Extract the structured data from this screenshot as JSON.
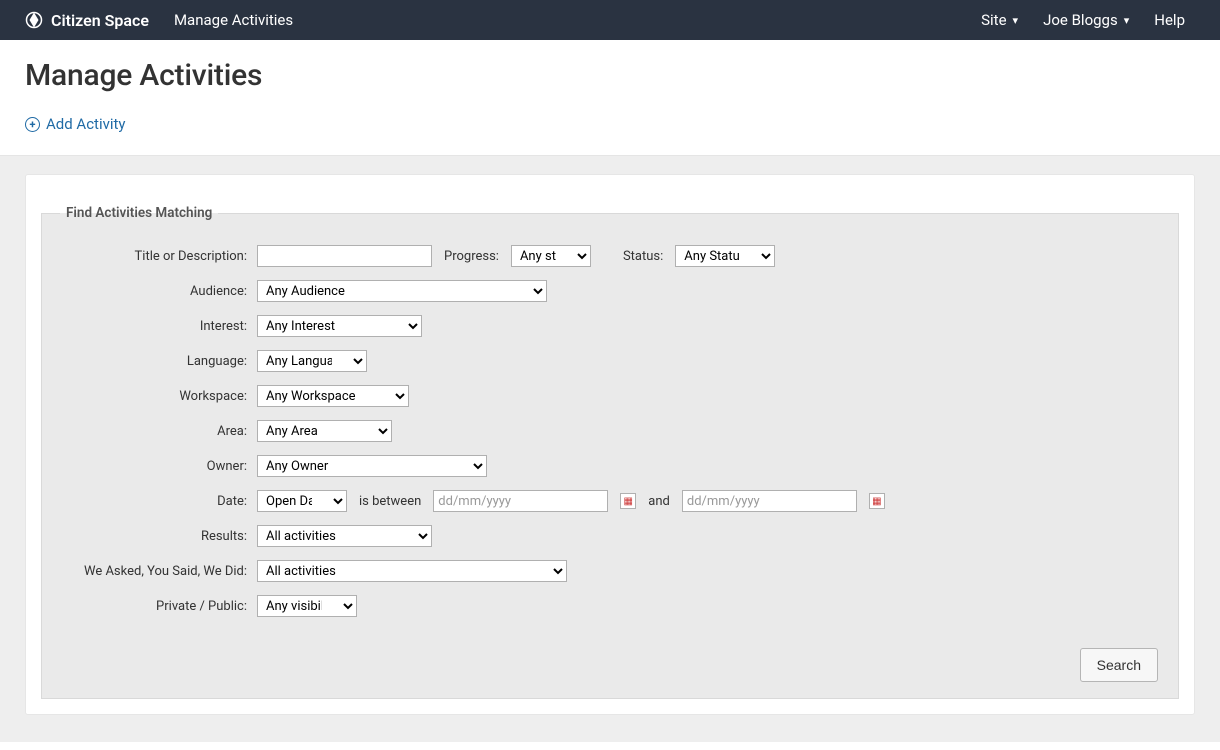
{
  "topbar": {
    "brand": "Citizen Space",
    "nav_manage": "Manage Activities",
    "site_label": "Site",
    "user_label": "Joe Bloggs",
    "help_label": "Help"
  },
  "header": {
    "title": "Manage Activities",
    "add_label": "Add Activity"
  },
  "filters": {
    "legend": "Find Activities Matching",
    "labels": {
      "title_desc": "Title or Description:",
      "progress": "Progress:",
      "status": "Status:",
      "audience": "Audience:",
      "interest": "Interest:",
      "language": "Language:",
      "workspace": "Workspace:",
      "area": "Area:",
      "owner": "Owner:",
      "date": "Date:",
      "date_between": "is between",
      "date_and": "and",
      "results": "Results:",
      "weasked": "We Asked, You Said, We Did:",
      "visibility": "Private / Public:"
    },
    "values": {
      "title_desc": "",
      "progress": "Any state",
      "status": "Any Status",
      "audience": "Any Audience",
      "interest": "Any Interest",
      "language": "Any Language",
      "workspace": "Any Workspace",
      "area": "Any Area",
      "owner": "Any Owner",
      "date_kind": "Open Date",
      "date_from_placeholder": "dd/mm/yyyy",
      "date_to_placeholder": "dd/mm/yyyy",
      "results": "All activities",
      "weasked": "All activities",
      "visibility": "Any visibility"
    },
    "search_button": "Search"
  }
}
